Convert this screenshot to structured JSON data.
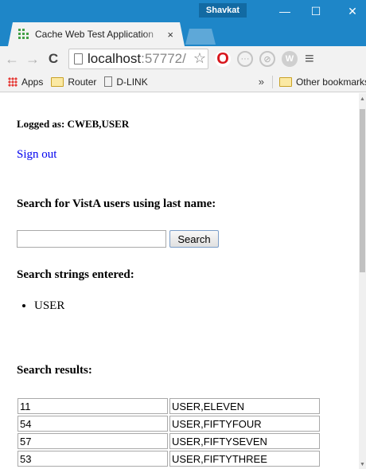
{
  "browser": {
    "user": "Shavkat",
    "tab_title": "Cache Web Test Application",
    "tab_close": "×",
    "url_host": "localhost",
    "url_port": ":57772/",
    "window_min": "—",
    "window_max": "☐",
    "window_close": "✕",
    "bookmarks": {
      "apps": "Apps",
      "router": "Router",
      "dlink": "D-LINK",
      "overflow": "»",
      "other": "Other bookmarks"
    },
    "accent": "#1e86c8"
  },
  "page": {
    "logged_as": "Logged as: CWEB,USER",
    "sign_out": "Sign out",
    "search_heading": "Search for VistA users using last name:",
    "search_value": "",
    "search_button": "Search",
    "strings_heading": "Search strings entered:",
    "strings": [
      "USER"
    ],
    "results_heading": "Search results:",
    "results": [
      [
        "11",
        "USER,ELEVEN"
      ],
      [
        "54",
        "USER,FIFTYFOUR"
      ],
      [
        "57",
        "USER,FIFTYSEVEN"
      ],
      [
        "53",
        "USER,FIFTYTHREE"
      ]
    ],
    "link_color": "#0000ee"
  }
}
